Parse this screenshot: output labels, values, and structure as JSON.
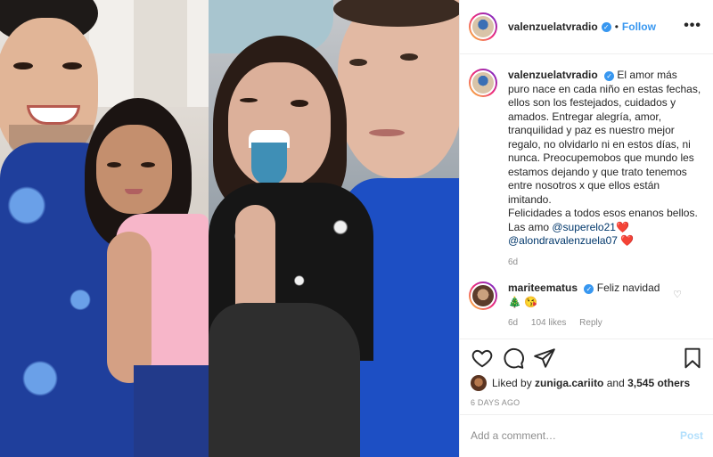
{
  "post": {
    "author": "valenzuelatvradio",
    "follow_label": "Follow",
    "dot": "•",
    "more_icon": "•••",
    "caption_parts": [
      "El amor más puro nace en cada niño en estas fechas, ellos son los festejados, cuidados y amados. Entregar alegría, amor, tranquilidad y paz es nuestro mejor regalo, no olvidarlo ni en estos días, ni nunca. Preocupemobos que mundo les estamos dejando y que trato tenemos entre nosotros x que ellos están imitando.",
      "Felicidades a todos esos enanos bellos.",
      "Las amo"
    ],
    "caption_mention_1": "@superelo21",
    "caption_mention_2": "@alondravalenzuela07",
    "heart_emoji": "❤️",
    "caption_age": "6d"
  },
  "comment": {
    "user": "mariteematus",
    "text": "Feliz navidad",
    "emojis": "🎄 😘",
    "age": "6d",
    "likes": "104 likes",
    "reply": "Reply",
    "heart": "♡"
  },
  "footer": {
    "liked_by_prefix": "Liked by",
    "liked_by_user": "zuniga.cariito",
    "and_label": "and",
    "others": "3,545 others",
    "date": "6 DAYS AGO",
    "add_placeholder": "Add a comment…",
    "post_label": "Post"
  },
  "icons": {
    "verified": "✓"
  },
  "colors": {
    "link_blue": "#3897f0",
    "mention_blue": "#00376b",
    "muted": "#8e8e8e",
    "post_disabled": "#b2dffc"
  }
}
